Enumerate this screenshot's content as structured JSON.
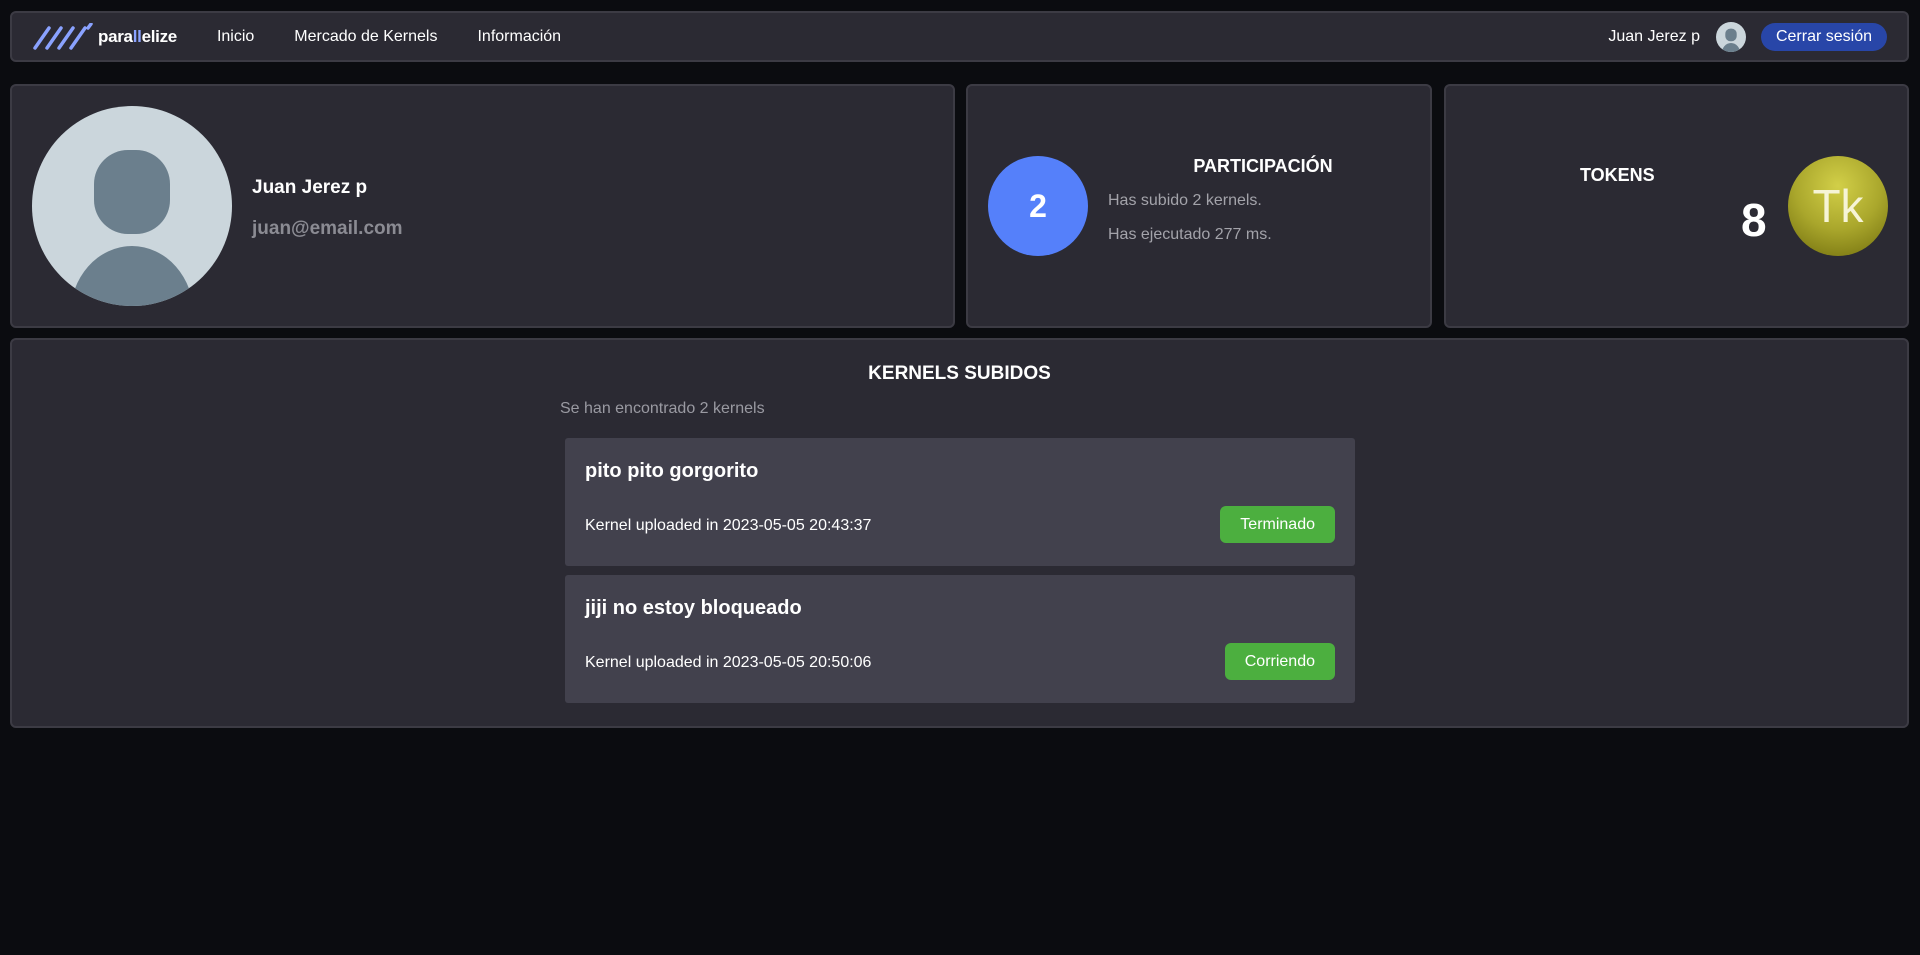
{
  "brand": {
    "logo_icon": "slashes-logo-icon",
    "name_part1": "para",
    "name_highlight": "ll",
    "name_part2": "elize",
    "accent_color": "#8aa2ff"
  },
  "nav": {
    "links": [
      "Inicio",
      "Mercado de Kernels",
      "Información"
    ],
    "user_name": "Juan Jerez p",
    "avatar_icon": "user-avatar-icon",
    "logout_label": "Cerrar sesión"
  },
  "profile": {
    "name": "Juan Jerez p",
    "email": "juan@email.com",
    "avatar_icon": "user-avatar-icon"
  },
  "participation": {
    "count": "2",
    "title": "PARTICIPACIÓN",
    "line1": "Has subido 2 kernels.",
    "line2": "Has ejecutado 277 ms.",
    "circle_color": "#5580fa"
  },
  "tokens": {
    "title": "TOKENS",
    "value": "8",
    "coin_label": "Tk",
    "coin_icon": "token-coin-icon"
  },
  "kernels": {
    "title": "KERNELS SUBIDOS",
    "count_text": "Se han encontrado 2 kernels",
    "items": [
      {
        "name": "pito pito gorgorito",
        "date_text": "Kernel uploaded in 2023-05-05 20:43:37",
        "status": "Terminado"
      },
      {
        "name": "jiji no estoy bloqueado",
        "date_text": "Kernel uploaded in 2023-05-05 20:50:06",
        "status": "Corriendo"
      }
    ],
    "status_color": "#4caf3f"
  }
}
